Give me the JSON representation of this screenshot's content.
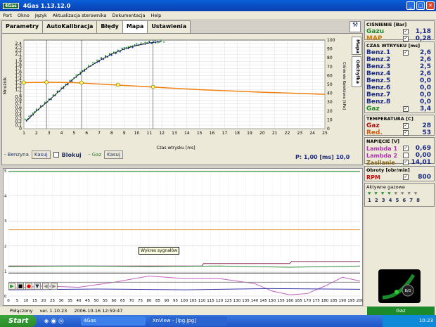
{
  "title": "4Gas   1.13.12.0",
  "logo": "4Gas",
  "menu": [
    "Port",
    "Okno",
    "Język",
    "Aktualizacja sterownika",
    "Dokumentacja",
    "Help"
  ],
  "tabs": [
    "Parametry",
    "AutoKalibracja",
    "Błędy",
    "Mapa",
    "Ustawienia"
  ],
  "vtabs": [
    "Mapa",
    "Odchyłka"
  ],
  "chart_data": [
    {
      "type": "scatter",
      "xlabel": "Czas wtrysku [ms]",
      "ylabel": "Mnożnik",
      "ylabel_right": "Ciśnienie Kolektora [kPa]",
      "xlim": [
        1,
        25
      ],
      "ylim": [
        0,
        2.5
      ],
      "ylim_right": [
        0,
        100
      ],
      "x_ticks": [
        1,
        2,
        3,
        4,
        5,
        6,
        7,
        8,
        9,
        10,
        11,
        12,
        13,
        14,
        15,
        16,
        17,
        18,
        19,
        20,
        21,
        22,
        23,
        24,
        25
      ],
      "y_ticks": [
        0,
        0.1,
        0.2,
        0.3,
        0.4,
        0.5,
        0.6,
        0.7,
        0.8,
        0.9,
        1,
        1.1,
        1.2,
        1.3,
        1.4,
        1.5,
        1.6,
        1.7,
        1.8,
        1.9,
        2,
        2.1,
        2.2,
        2.3,
        2.4
      ],
      "y_tick_labels": [
        "0",
        "0,1",
        "0,2",
        "0,3",
        "0,4",
        "0,5",
        "0,6",
        "0,7",
        "0,8",
        "0,9",
        "1",
        "1,1",
        "1,2",
        "1,3",
        "1,4",
        "1,5",
        "1,6",
        "1,7",
        "1,8",
        "1,9",
        "2",
        "2,1",
        "2,2",
        "2,3",
        "2,4"
      ],
      "y_right_ticks": [
        0,
        10,
        20,
        30,
        40,
        50,
        60,
        70,
        80,
        90,
        100
      ],
      "series": [
        {
          "name": "Benzyna",
          "x": [
            1.2,
            2,
            3,
            4,
            5,
            6,
            7,
            8,
            9,
            10,
            11,
            12
          ],
          "y": [
            0.22,
            0.5,
            0.8,
            1.12,
            1.42,
            1.7,
            1.92,
            2.1,
            2.25,
            2.35,
            2.42,
            2.46
          ]
        },
        {
          "name": "Gaz",
          "x": [
            1.1,
            2,
            3,
            4,
            5,
            6,
            7,
            8,
            9,
            10,
            11,
            12.4
          ],
          "y": [
            0.24,
            0.52,
            0.82,
            1.14,
            1.45,
            1.72,
            1.95,
            2.12,
            2.27,
            2.37,
            2.44,
            2.48
          ]
        },
        {
          "name": "Mnożnik",
          "x": [
            1,
            3,
            5,
            8,
            11,
            15,
            20,
            25
          ],
          "y": [
            1.3,
            1.31,
            1.3,
            1.24,
            1.18,
            1.1,
            1.03,
            0.97
          ]
        }
      ],
      "marker_points": {
        "x": [
          1,
          2.8,
          5.6,
          8.5,
          11.3
        ],
        "y": [
          1.3,
          1.31,
          1.3,
          1.24,
          1.18
        ]
      },
      "vlines": [
        2.8,
        5.6,
        11.3
      ]
    },
    {
      "type": "line",
      "xlim": [
        0,
        200
      ],
      "ylim": [
        0,
        5
      ],
      "x_ticks": [
        0,
        5,
        10,
        15,
        20,
        25,
        30,
        35,
        40,
        45,
        50,
        55,
        60,
        65,
        70,
        75,
        80,
        85,
        90,
        95,
        100,
        105,
        110,
        115,
        120,
        125,
        130,
        135,
        140,
        145,
        150,
        155,
        160,
        165,
        170,
        175,
        180,
        185,
        190,
        195,
        200
      ],
      "y_ticks": [
        0,
        1,
        2,
        3,
        4,
        5
      ],
      "series": [
        {
          "color": "#1a8a2a",
          "x": [
            0,
            200
          ],
          "y": [
            4.98,
            4.98
          ]
        },
        {
          "color": "#e8a050",
          "x": [
            0,
            200
          ],
          "y": [
            2.65,
            2.65
          ]
        },
        {
          "color": "#8a2a5a",
          "x": [
            0,
            110,
            111,
            160,
            161,
            200
          ],
          "y": [
            1.2,
            1.2,
            1.3,
            1.3,
            1.38,
            1.38
          ]
        },
        {
          "color": "#2a8a3a",
          "x": [
            0,
            40,
            80,
            120,
            160,
            200
          ],
          "y": [
            1.18,
            1.2,
            1.18,
            1.2,
            1.15,
            1.2
          ]
        },
        {
          "color": "#333333",
          "x": [
            0,
            200
          ],
          "y": [
            0.92,
            0.92
          ]
        },
        {
          "color": "#c060c0",
          "x": [
            0,
            20,
            40,
            60,
            80,
            100,
            120,
            140,
            150,
            160,
            170,
            180,
            190,
            200
          ],
          "y": [
            0.3,
            0.4,
            0.35,
            0.55,
            0.8,
            0.7,
            0.7,
            0.5,
            0.2,
            0.05,
            0.1,
            0.4,
            0.75,
            0.6
          ]
        },
        {
          "color": "#3333aa",
          "x": [
            0,
            50,
            100,
            150,
            200
          ],
          "y": [
            0.25,
            0.28,
            0.25,
            0.3,
            0.27
          ]
        },
        {
          "color": "#888888",
          "x": [
            0,
            200
          ],
          "y": [
            0.55,
            0.55
          ]
        }
      ]
    }
  ],
  "legend": {
    "benzyna": "Benzyna",
    "kasuj": "Kasuj",
    "blokuj": "Blokuj",
    "gaz": "Gaz",
    "kasuj2": "Kasuj"
  },
  "pvalue": "P:  1,00 [ms]  10,0",
  "tooltip": "Wykres sygnałów",
  "pressure": {
    "header": "CIŚNIENIE [Bar]",
    "rows": [
      {
        "label": "Gazu",
        "value": "1,18",
        "color": "#1a8a2a"
      },
      {
        "label": "MAP",
        "value": "0,28",
        "color": "#c07a10"
      }
    ]
  },
  "injection": {
    "header": "CZAS WTRYSKU [ms]",
    "rows": [
      {
        "label": "Benz.1",
        "value": "2,6"
      },
      {
        "label": "Benz.2",
        "value": "2,6"
      },
      {
        "label": "Benz.3",
        "value": "2,5"
      },
      {
        "label": "Benz.4",
        "value": "2,6"
      },
      {
        "label": "Benz.5",
        "value": "0,0"
      },
      {
        "label": "Benz.6",
        "value": "0,0"
      },
      {
        "label": "Benz.7",
        "value": "0,0"
      },
      {
        "label": "Benz.8",
        "value": "0,0"
      },
      {
        "label": "Gaz",
        "value": "3,4"
      }
    ]
  },
  "temperature": {
    "header": "TEMPERATURA [C]",
    "rows": [
      {
        "label": "Gaz",
        "value": "28",
        "color": "#b01010"
      },
      {
        "label": "Red.",
        "value": "53",
        "color": "#d06010"
      }
    ]
  },
  "voltage": {
    "header": "NAPIĘCIE [V]",
    "rows": [
      {
        "label": "Lambda 1",
        "value": "0,69",
        "color": "#b030b0"
      },
      {
        "label": "Lambda 2",
        "value": "0,00",
        "color": "#b030b0"
      },
      {
        "label": "Zasilanie",
        "value": "14,01",
        "color": "#806010"
      }
    ]
  },
  "rpm": {
    "header": "Obroty [obr/min]",
    "label": "RPM",
    "value": "800"
  },
  "active": {
    "header": "Aktywne gazowe",
    "nums": [
      "1",
      "2",
      "3",
      "4",
      "5",
      "6",
      "7",
      "8"
    ]
  },
  "status": {
    "conn": "Połączony",
    "ver": "ver. 1.10.23",
    "date": "2006-10-16  12:59:47",
    "gaz": "Gaz"
  },
  "taskbar": {
    "start": "Start",
    "t1": "4Gas",
    "t2": "XnView - [lpg.jpg]",
    "clock": "10:23"
  },
  "gauge_label": "B/G"
}
